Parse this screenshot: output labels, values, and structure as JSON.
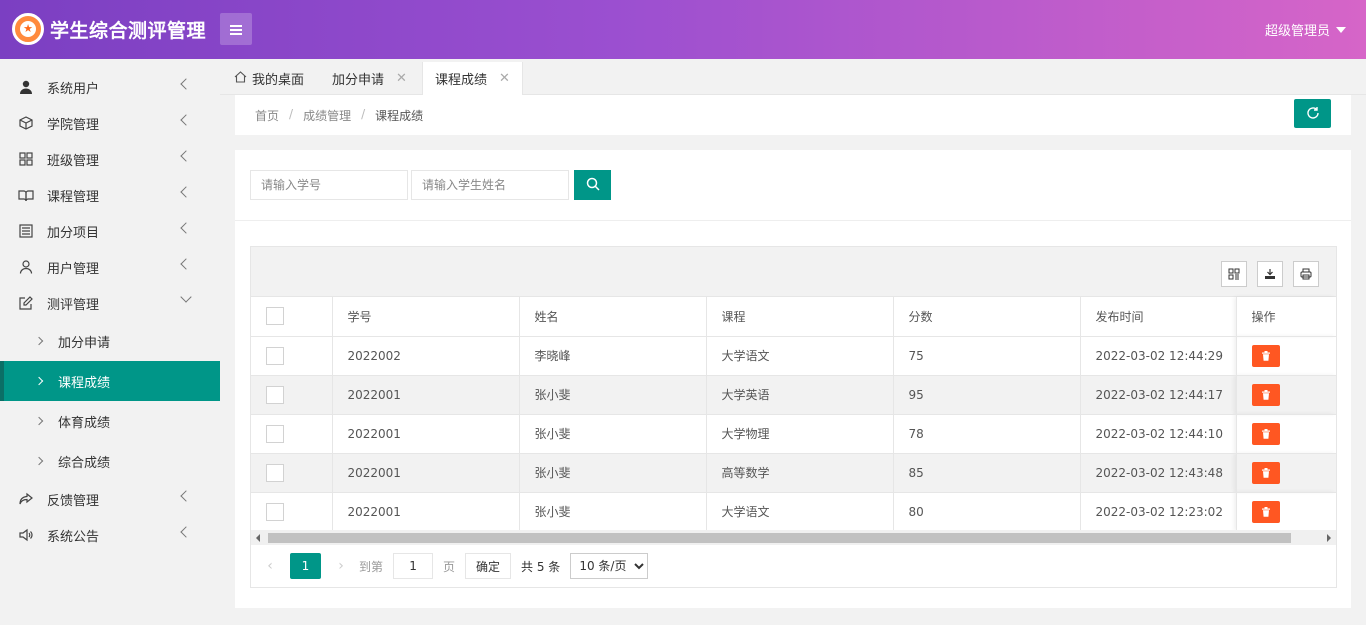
{
  "header": {
    "title": "学生综合测评管理",
    "user": "超级管理员"
  },
  "sidebar": {
    "items": [
      {
        "label": "系统用户",
        "icon": "user-icon"
      },
      {
        "label": "学院管理",
        "icon": "cube-icon"
      },
      {
        "label": "班级管理",
        "icon": "grid-icon"
      },
      {
        "label": "课程管理",
        "icon": "book-icon"
      },
      {
        "label": "加分项目",
        "icon": "list-icon"
      },
      {
        "label": "用户管理",
        "icon": "person-icon"
      },
      {
        "label": "测评管理",
        "icon": "edit-icon"
      }
    ],
    "sub_items": [
      {
        "label": "加分申请"
      },
      {
        "label": "课程成绩"
      },
      {
        "label": "体育成绩"
      },
      {
        "label": "综合成绩"
      }
    ],
    "bottom_items": [
      {
        "label": "反馈管理",
        "icon": "share-icon"
      },
      {
        "label": "系统公告",
        "icon": "speaker-icon"
      }
    ]
  },
  "tabs": [
    {
      "label": "我的桌面"
    },
    {
      "label": "加分申请"
    },
    {
      "label": "课程成绩"
    }
  ],
  "breadcrumb": {
    "home": "首页",
    "section": "成绩管理",
    "current": "课程成绩",
    "separator": "/"
  },
  "search": {
    "student_id_placeholder": "请输入学号",
    "student_name_placeholder": "请输入学生姓名"
  },
  "table": {
    "headers": {
      "id": "学号",
      "name": "姓名",
      "course": "课程",
      "score": "分数",
      "time": "发布时间",
      "op": "操作"
    },
    "rows": [
      {
        "id": "2022002",
        "name": "李晓峰",
        "course": "大学语文",
        "score": "75",
        "time": "2022-03-02 12:44:29"
      },
      {
        "id": "2022001",
        "name": "张小斐",
        "course": "大学英语",
        "score": "95",
        "time": "2022-03-02 12:44:17"
      },
      {
        "id": "2022001",
        "name": "张小斐",
        "course": "大学物理",
        "score": "78",
        "time": "2022-03-02 12:44:10"
      },
      {
        "id": "2022001",
        "name": "张小斐",
        "course": "高等数学",
        "score": "85",
        "time": "2022-03-02 12:43:48"
      },
      {
        "id": "2022001",
        "name": "张小斐",
        "course": "大学语文",
        "score": "80",
        "time": "2022-03-02 12:23:02"
      }
    ]
  },
  "pager": {
    "current_page": "1",
    "goto_label": "到第",
    "goto_value": "1",
    "page_unit": "页",
    "confirm": "确定",
    "total": "共 5 条",
    "page_size": "10 条/页"
  },
  "colors": {
    "primary": "#009688",
    "danger": "#ff5722",
    "header_from": "#7b3fc2",
    "header_to": "#d665c8"
  }
}
